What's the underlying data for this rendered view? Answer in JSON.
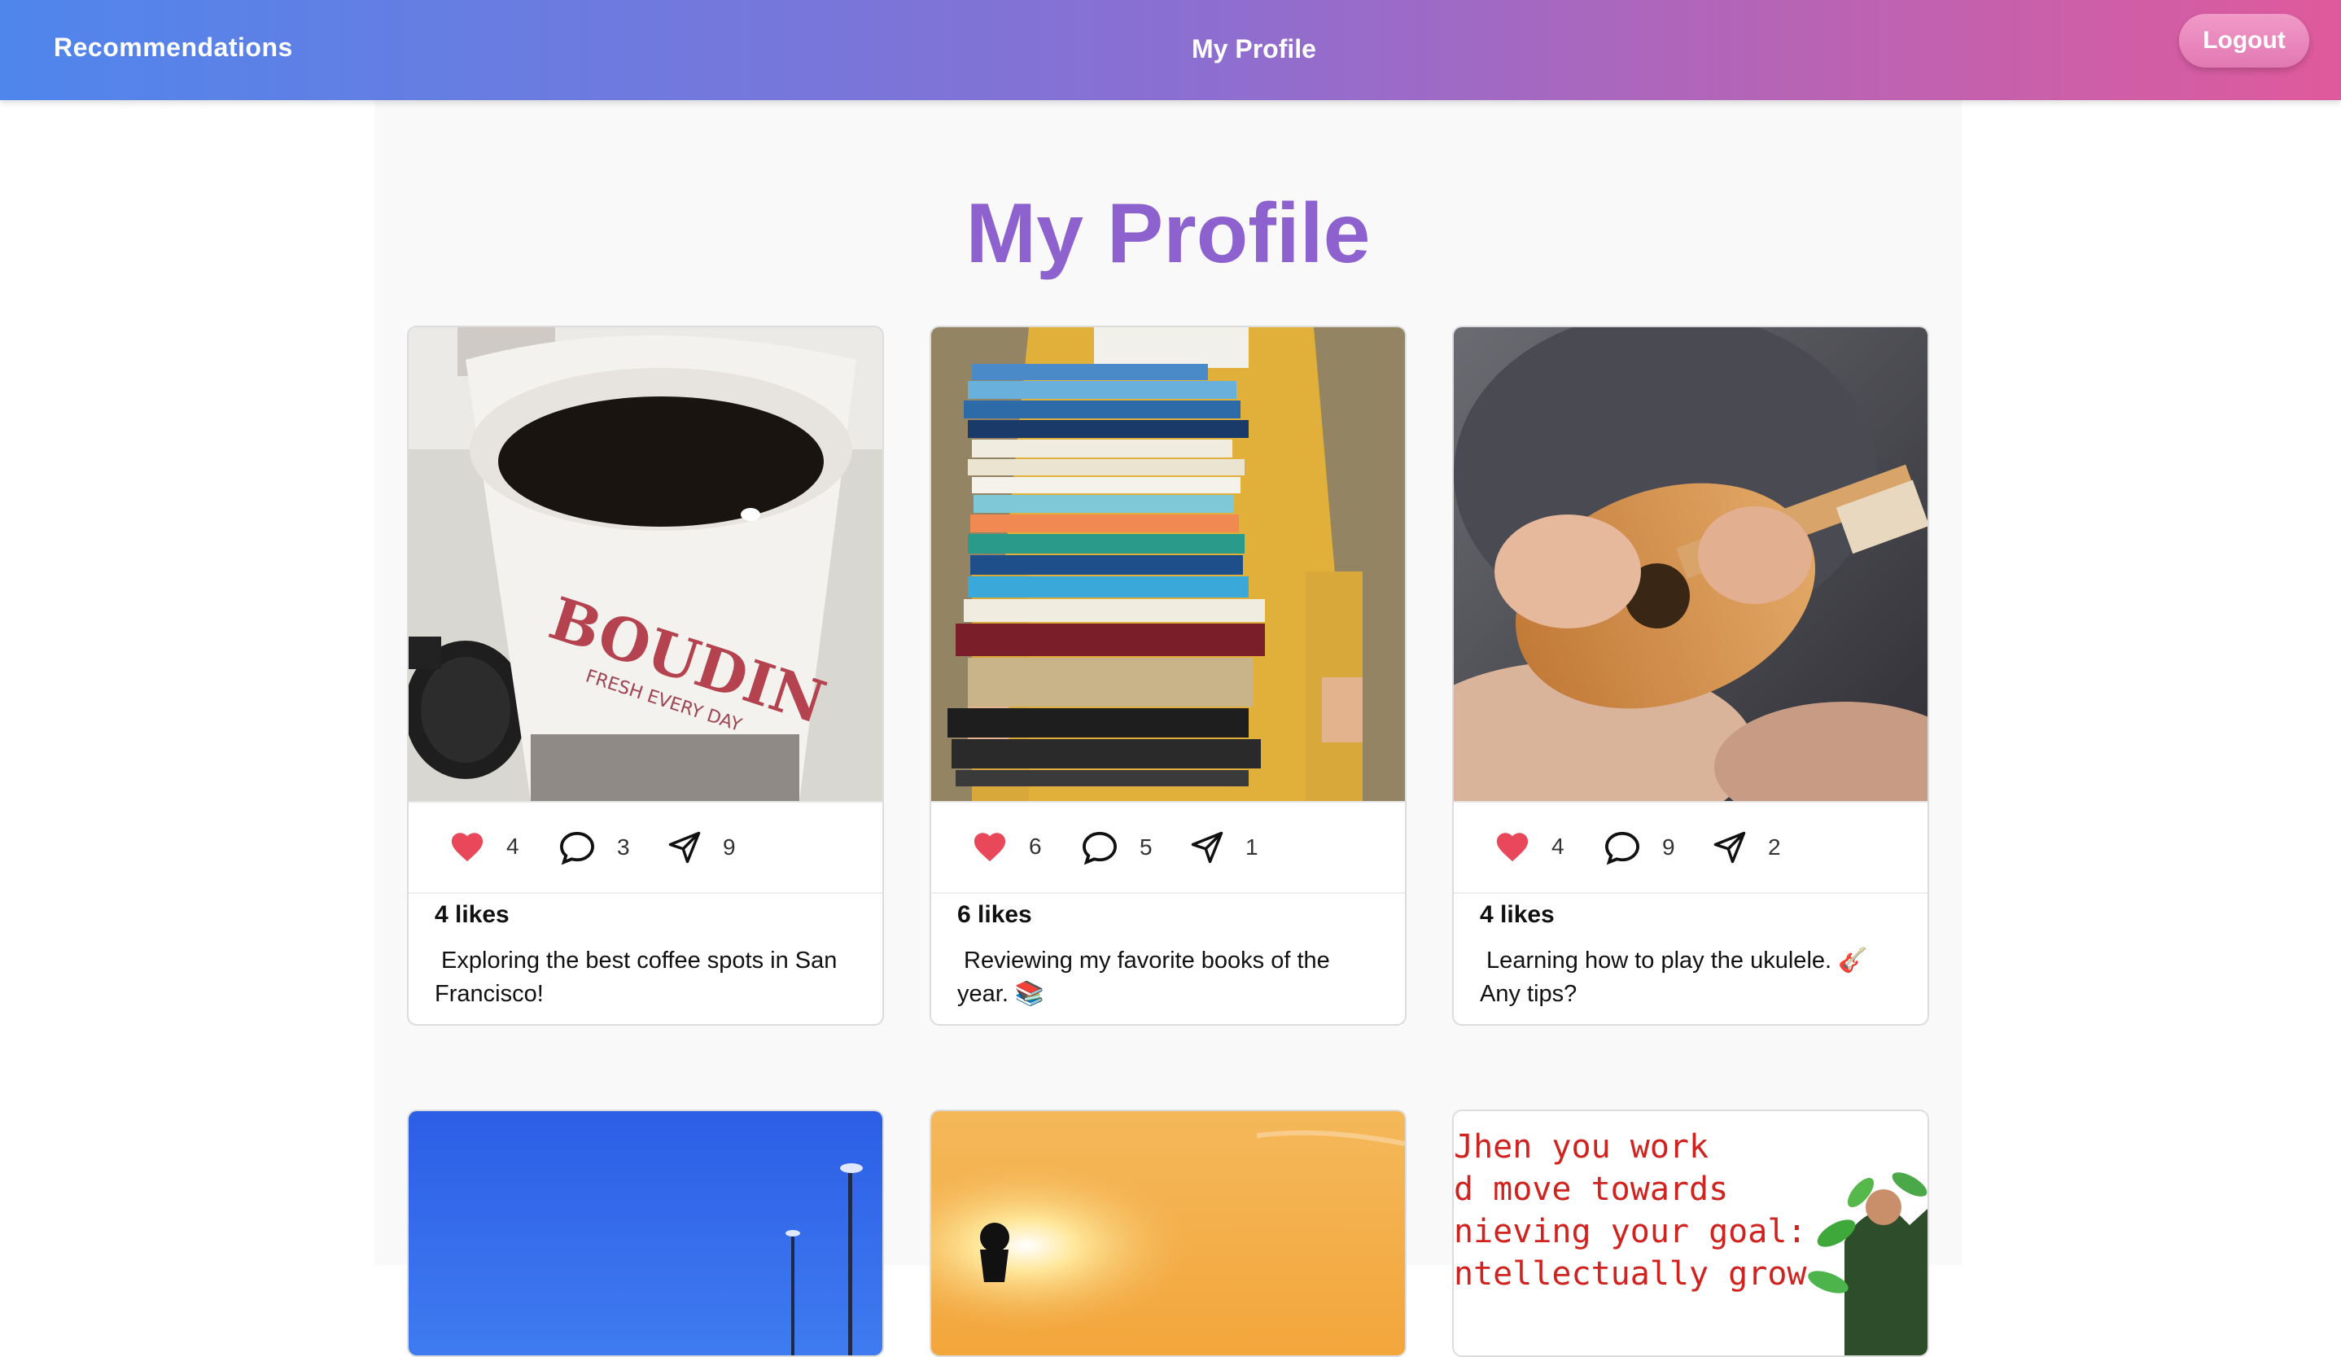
{
  "navbar": {
    "left_link": "Recommendations",
    "center_title": "My Profile",
    "logout_label": "Logout"
  },
  "page": {
    "title": "My Profile"
  },
  "posts": [
    {
      "image": "coffee-cup-photo",
      "likes_count": "4",
      "comments_count": "3",
      "shares_count": "9",
      "likes_text": "4 likes",
      "caption_line1": " Exploring the best coffee spots in San",
      "caption_line2": "Francisco!"
    },
    {
      "image": "stack-of-books-photo",
      "likes_count": "6",
      "comments_count": "5",
      "shares_count": "1",
      "likes_text": "6 likes",
      "caption_line1": " Reviewing my favorite books of the",
      "caption_line2": "year. 📚"
    },
    {
      "image": "ukulele-photo",
      "likes_count": "4",
      "comments_count": "9",
      "shares_count": "2",
      "likes_text": "4 likes",
      "caption_line1": " Learning how to play the ukulele. 🎸",
      "caption_line2": "Any tips?"
    },
    {
      "image": "blue-sky-streetlights-photo"
    },
    {
      "image": "sunset-silhouette-photo"
    },
    {
      "image": "motivational-quote-image",
      "quote_line1": "Jhen you work",
      "quote_line2": "d move towards",
      "quote_line3": "nieving your goal:",
      "quote_line4": "ntellectually grow"
    }
  ],
  "colors": {
    "nav_gradient_start": "#4f86ec",
    "nav_gradient_end": "#df5a9c",
    "title_purple": "#8d62cf",
    "heart_red": "#e8485a",
    "quote_red": "#d0221f"
  }
}
